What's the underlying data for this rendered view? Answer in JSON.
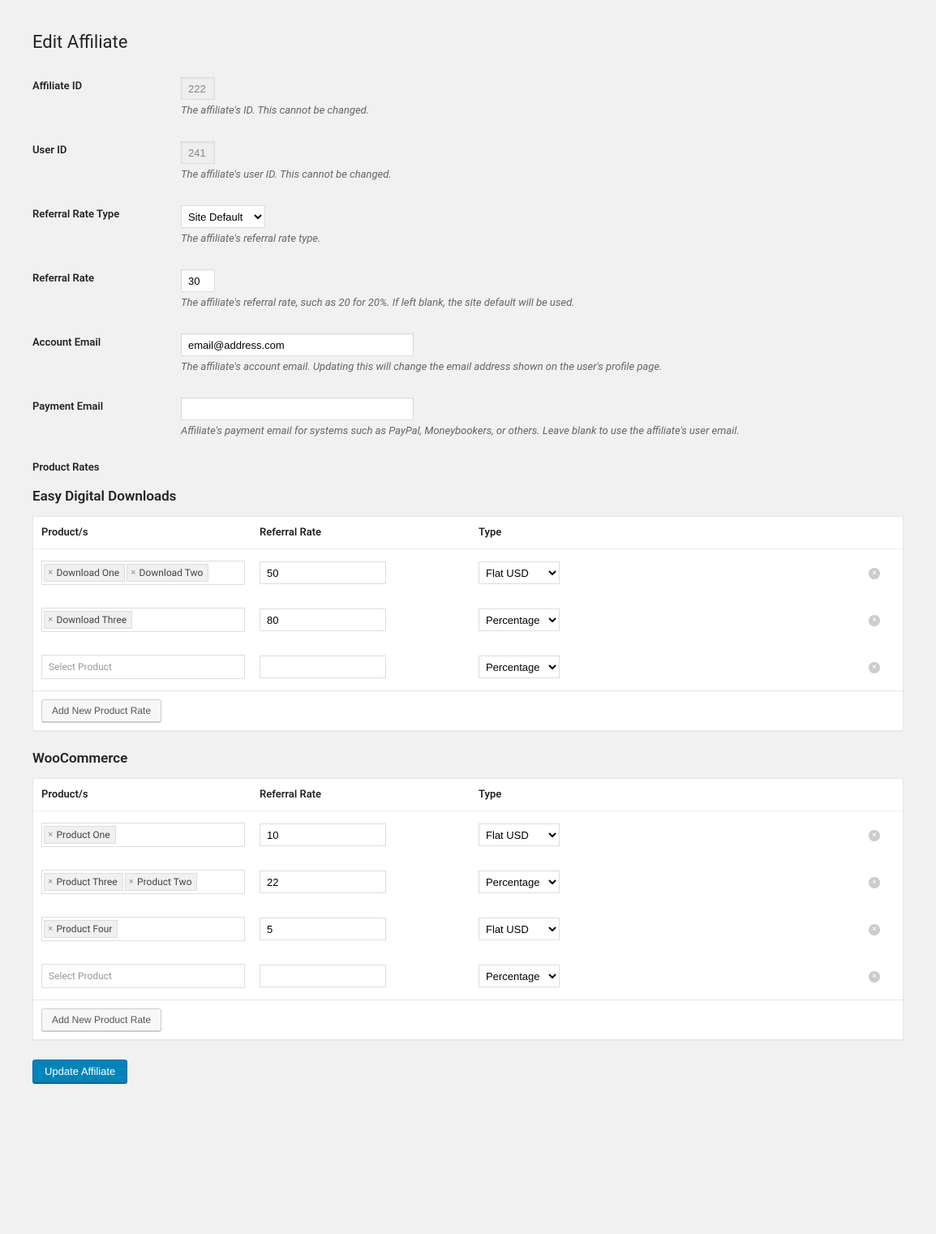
{
  "page": {
    "title": "Edit Affiliate"
  },
  "fields": {
    "affiliate_id": {
      "label": "Affiliate ID",
      "value": "222",
      "desc": "The affiliate's ID. This cannot be changed."
    },
    "user_id": {
      "label": "User ID",
      "value": "241",
      "desc": "The affiliate's user ID. This cannot be changed."
    },
    "rate_type": {
      "label": "Referral Rate Type",
      "value": "Site Default",
      "desc": "The affiliate's referral rate type."
    },
    "rate": {
      "label": "Referral Rate",
      "value": "30",
      "desc": "The affiliate's referral rate, such as 20 for 20%. If left blank, the site default will be used."
    },
    "account_email": {
      "label": "Account Email",
      "value": "email@address.com",
      "desc": "The affiliate's account email. Updating this will change the email address shown on the user's profile page."
    },
    "payment_email": {
      "label": "Payment Email",
      "value": "",
      "desc": "Affiliate's payment email for systems such as PayPal, Moneybookers, or others. Leave blank to use the affiliate's user email."
    }
  },
  "product_rates": {
    "section_label": "Product Rates",
    "columns": {
      "product": "Product/s",
      "rate": "Referral Rate",
      "type": "Type"
    },
    "placeholder": "Select Product",
    "add_button": "Add New Product Rate",
    "type_options": {
      "flat": "Flat USD",
      "percentage": "Percentage (%)"
    },
    "sections": [
      {
        "title": "Easy Digital Downloads",
        "rows": [
          {
            "products": [
              "Download One",
              "Download Two"
            ],
            "rate": "50",
            "type": "Flat USD"
          },
          {
            "products": [
              "Download Three"
            ],
            "rate": "80",
            "type": "Percentage (%)"
          },
          {
            "products": [],
            "rate": "",
            "type": "Percentage (%)"
          }
        ]
      },
      {
        "title": "WooCommerce",
        "rows": [
          {
            "products": [
              "Product One"
            ],
            "rate": "10",
            "type": "Flat USD"
          },
          {
            "products": [
              "Product Three",
              "Product Two"
            ],
            "rate": "22",
            "type": "Percentage (%)"
          },
          {
            "products": [
              "Product Four"
            ],
            "rate": "5",
            "type": "Flat USD"
          },
          {
            "products": [],
            "rate": "",
            "type": "Percentage (%)"
          }
        ]
      }
    ]
  },
  "submit": {
    "label": "Update Affiliate"
  }
}
